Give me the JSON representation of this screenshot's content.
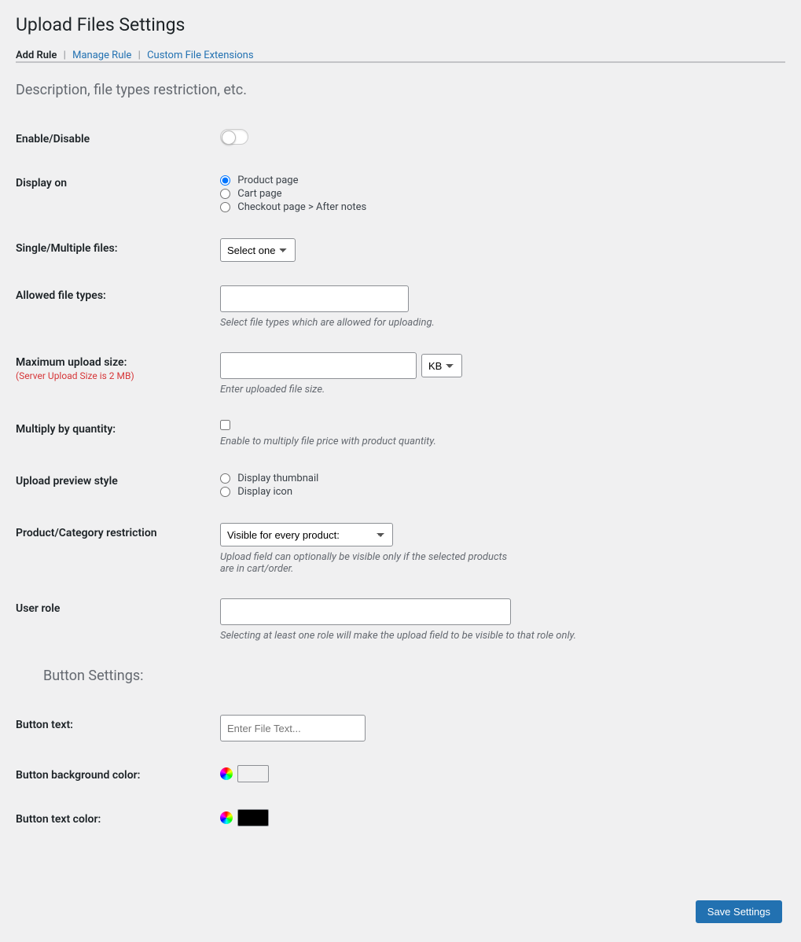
{
  "page_title": "Upload Files Settings",
  "tabs": {
    "add_rule": "Add Rule",
    "manage_rule": "Manage Rule",
    "custom_ext": "Custom File Extensions"
  },
  "section1_title": "Description, file types restriction, etc.",
  "fields": {
    "enable_label": "Enable/Disable",
    "display_on_label": "Display on",
    "display_on_options": {
      "product": "Product page",
      "cart": "Cart page",
      "checkout": "Checkout page > After notes"
    },
    "single_multiple_label": "Single/Multiple files:",
    "single_multiple_value": "Select one",
    "allowed_types_label": "Allowed file types:",
    "allowed_types_desc": "Select file types which are allowed for uploading.",
    "max_size_label": "Maximum upload size:",
    "max_size_server_note": "(Server Upload Size is 2 MB)",
    "max_size_unit": "KB",
    "max_size_desc": "Enter uploaded file size.",
    "multiply_label": "Multiply by quantity:",
    "multiply_desc": "Enable to multiply file price with product quantity.",
    "preview_label": "Upload preview style",
    "preview_options": {
      "thumbnail": "Display thumbnail",
      "icon": "Display icon"
    },
    "restriction_label": "Product/Category restriction",
    "restriction_value": "Visible for every product:",
    "restriction_desc": "Upload field can optionally be visible only if the selected products are in cart/order.",
    "user_role_label": "User role",
    "user_role_desc": "Selecting at least one role will make the upload field to be visible to that role only."
  },
  "section2_title": "Button Settings:",
  "button_fields": {
    "text_label": "Button text:",
    "text_placeholder": "Enter File Text...",
    "bg_color_label": "Button background color:",
    "bg_color_value": "#ffffff",
    "text_color_label": "Button text color:",
    "text_color_value": "#000000"
  },
  "save_button": "Save Settings"
}
